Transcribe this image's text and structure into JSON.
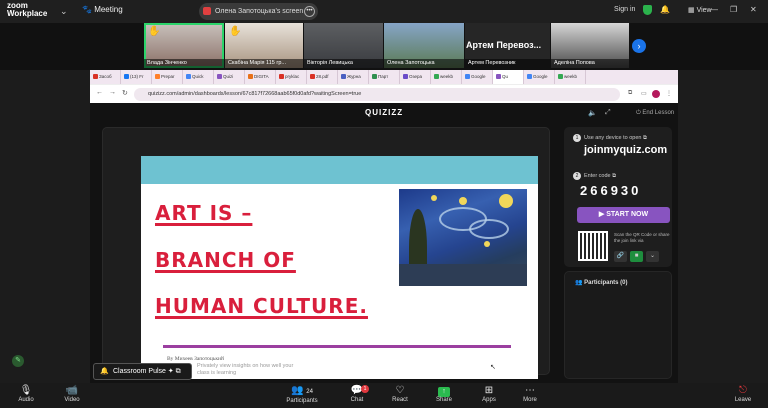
{
  "app": {
    "logo_line1": "zoom",
    "logo_line2": "Workplace",
    "meeting_label": "Meeting"
  },
  "share": {
    "title": "Олена Запотоцька's screen"
  },
  "top": {
    "signin": "Sign in",
    "view": "View"
  },
  "participants_strip": [
    {
      "name": "Влада Зінченко"
    },
    {
      "name": "Скабіна Марія 115 гр..."
    },
    {
      "name": "Вікторія Левицька"
    },
    {
      "name": "Олена Запотоцька"
    },
    {
      "name": "Артем Перевозник"
    },
    {
      "name": "Аделіна Попова"
    }
  ],
  "speaker_big_name": "Артем Перевоз...",
  "browser": {
    "tabs": [
      "Засоб",
      "(13) Fr",
      "Prepar",
      "Quick",
      "Quizi",
      "DIGITA",
      "pryklac",
      "28.pdf",
      "Журна",
      "Парт",
      "Озера",
      "weekb",
      "Google",
      "Qu",
      "Google",
      "weekb"
    ],
    "url": "quizizz.com/admin/dashboards/lesson/67c817f72668aab65f0d0afd?waitingScreen=true"
  },
  "quiz": {
    "logo": "QUIZIZZ",
    "end_lesson": "End Lesson",
    "step1": "Use any device to open",
    "join_url": "joinmyquiz.com",
    "step2": "Enter code",
    "code": "266930",
    "start_now": "▶ START NOW",
    "scan_text": "Scan the QR Code or share the join link via",
    "participants": "Participants (0)"
  },
  "slide": {
    "line1": "ART IS –",
    "line2": "BRANCH OF",
    "line3": "HUMAN CULTURE.",
    "byline": "By Михеев Запотоцький"
  },
  "pulse": {
    "label": "Classroom Pulse",
    "desc": "Privately view insights on how well your class is learning"
  },
  "bottom": {
    "audio": "Audio",
    "video": "Video",
    "participants": "Participants",
    "participants_count": "24",
    "chat": "Chat",
    "chat_badge": "1",
    "react": "React",
    "share": "Share",
    "apps": "Apps",
    "more": "More",
    "leave": "Leave"
  },
  "colors": {
    "accent_green": "#2bd46a",
    "quiz_purple": "#8854c0",
    "slide_red": "#d91f3c",
    "slide_header": "#6ec2d1"
  }
}
